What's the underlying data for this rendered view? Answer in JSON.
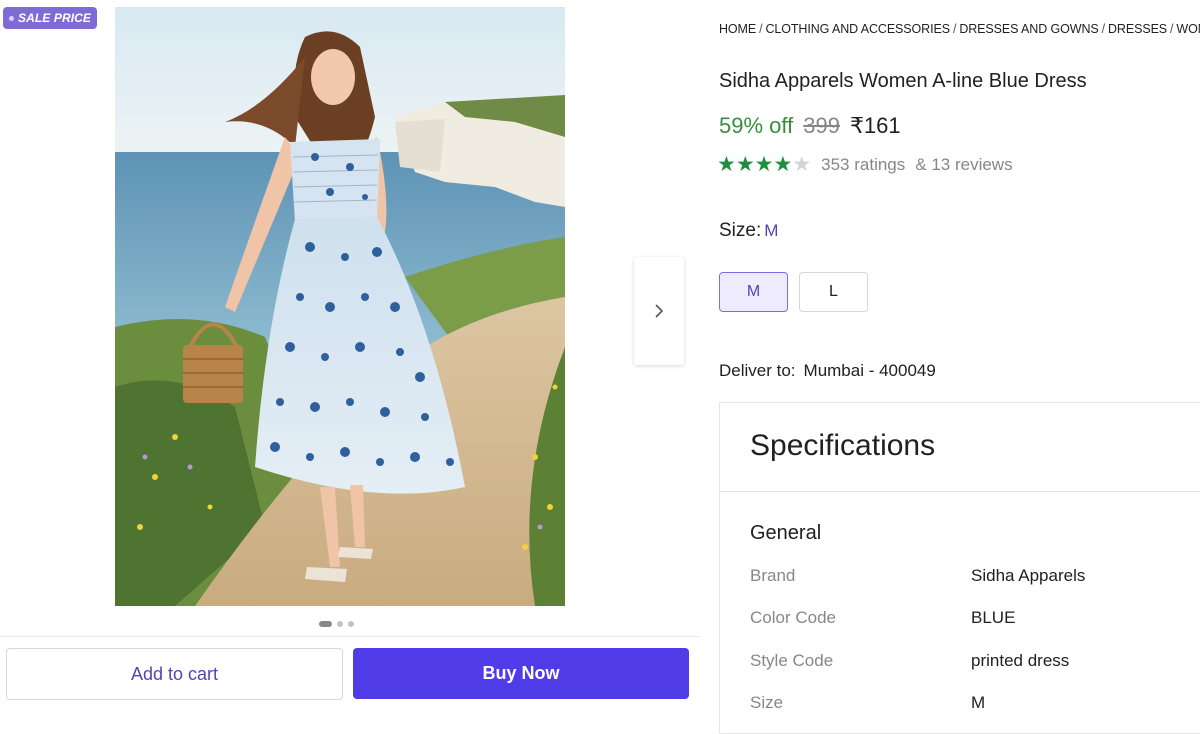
{
  "badge": {
    "label": "SALE PRICE"
  },
  "gallery": {
    "active_index": 0,
    "dot_count": 3
  },
  "actions": {
    "add_to_cart": "Add to cart",
    "buy_now": "Buy Now"
  },
  "breadcrumb": [
    "HOME",
    "CLOTHING AND ACCESSORIES",
    "DRESSES AND GOWNS",
    "DRESSES",
    "WOMEN'S DRESSES"
  ],
  "product": {
    "title": "Sidha Apparels Women A-line Blue Dress",
    "discount": "59% off",
    "mrp": "399",
    "price": "₹161",
    "rating_stars": 4,
    "ratings": "353 ratings",
    "reviews": "& 13 reviews"
  },
  "size": {
    "label": "Size:",
    "selected": "M",
    "options": [
      "M",
      "L"
    ]
  },
  "delivery": {
    "label": "Deliver to:",
    "location": "Mumbai - 400049"
  },
  "specs": {
    "title": "Specifications",
    "section": "General",
    "rows": [
      {
        "key": "Brand",
        "value": "Sidha Apparels"
      },
      {
        "key": "Color Code",
        "value": "BLUE"
      },
      {
        "key": "Style Code",
        "value": "printed dress"
      },
      {
        "key": "Size",
        "value": "M"
      }
    ]
  },
  "colors": {
    "accent": "#4f3be8",
    "discount_green": "#388e3c",
    "star_green": "#1c8f3c",
    "badge": "#7e6bd6"
  }
}
